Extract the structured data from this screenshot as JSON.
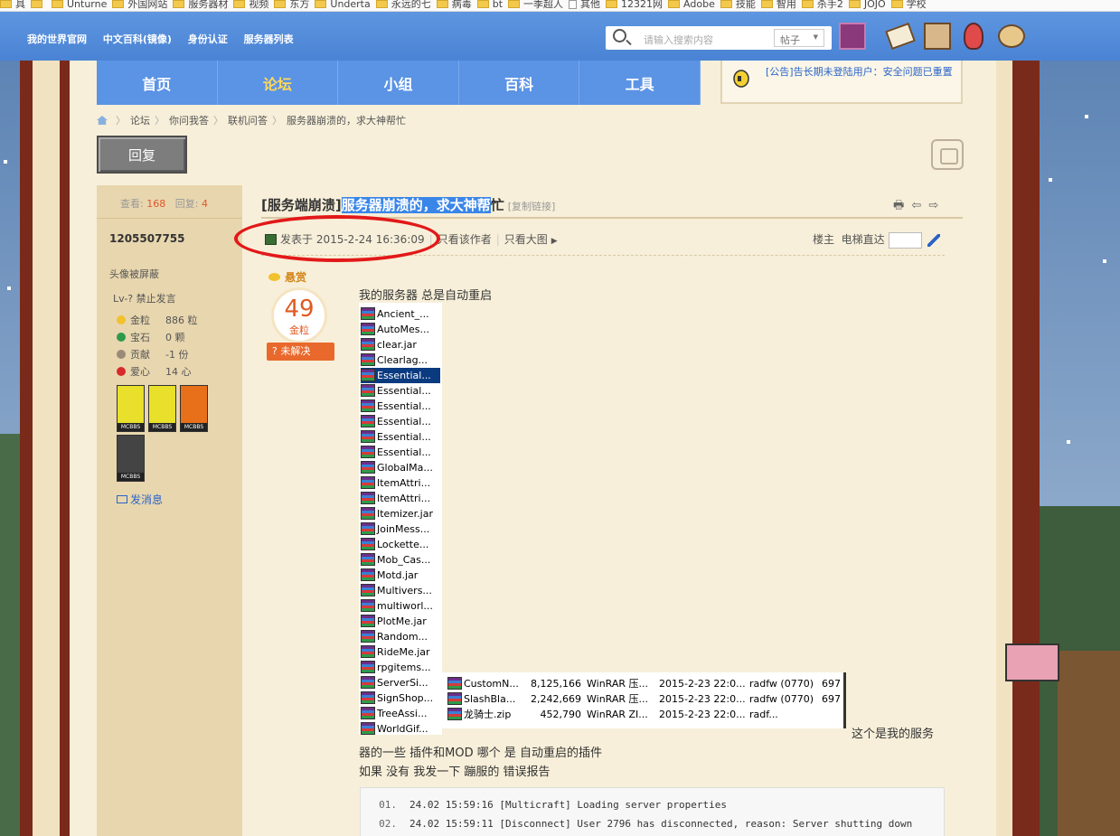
{
  "bookmarks": [
    "具",
    "",
    "Unturne",
    "外国网站",
    "服务器材",
    "视频",
    "东方",
    "Underta",
    "永远的七",
    "病毒",
    "bt",
    "一季超人",
    "其他",
    "12321网",
    "Adobe",
    "技能",
    "智用",
    "杀手2",
    "JOJO",
    "学校"
  ],
  "topnav": {
    "links": [
      "我的世界官网",
      "中文百科(镜像)",
      "身份认证",
      "服务器列表"
    ],
    "search_placeholder": "请输入搜索内容",
    "search_scope": "帖子"
  },
  "forumnav": {
    "tabs": [
      "首页",
      "论坛",
      "小组",
      "百科",
      "工具"
    ],
    "active": 1
  },
  "notice": "[公告]告长期未登陆用户：安全问题已重置",
  "breadcrumb": [
    "论坛",
    "你问我答",
    "联机问答",
    "服务器崩溃的，求大神帮忙"
  ],
  "reply_button": "回复",
  "stats": {
    "views_label": "查看:",
    "views": "168",
    "replies_label": "回复:",
    "replies": "4"
  },
  "user": {
    "name": "1205507755",
    "avatar_note": "头像被屏蔽",
    "level": "Lv-? 禁止发言",
    "stats": [
      {
        "label": "金粒",
        "value": "886 粒",
        "color": "#f2c12e"
      },
      {
        "label": "宝石",
        "value": "0 颗",
        "color": "#2e9a4a"
      },
      {
        "label": "贡献",
        "value": "-1 份",
        "color": "#9a8a78"
      },
      {
        "label": "爱心",
        "value": "14 心",
        "color": "#d82a2a"
      }
    ],
    "medals": [
      "MCBBS",
      "MCBBS",
      "MCBBS",
      "MCBBS"
    ],
    "send_message": "发消息"
  },
  "post": {
    "title_prefix": "[服务端崩溃]",
    "title_highlight": "服务器崩溃的，求大神帮",
    "title_rest": "忙",
    "copy_link": "[复制链接]",
    "title_icons": "🖶 ⇦ ⇨",
    "posted": "发表于 2015-2-24 16:36:09",
    "view_author": "只看该作者",
    "view_big": "只看大图",
    "floor_owner": "楼主",
    "elevator": "电梯直达",
    "bounty_label": "悬赏",
    "bounty_amount": "49",
    "bounty_unit": "金粒",
    "unsolved": "? 未解决",
    "line1": "我的服务器 总是自动重启",
    "tail": "这个是我的服务",
    "line2": "器的一些   插件和MOD  哪个 是 自动重启的插件",
    "line3": "如果 没有 我发一下 蹦服的 错误报告"
  },
  "files": [
    "Ancient_...",
    "AutoMes...",
    "clear.jar",
    "Clearlag...",
    "Essential...",
    "Essential...",
    "Essential...",
    "Essential...",
    "Essential...",
    "Essential...",
    "GlobalMa...",
    "ItemAttri...",
    "ItemAttri...",
    "Itemizer.jar",
    "JoinMess...",
    "Lockette...",
    "Mob_Cas...",
    "Motd.jar",
    "Multivers...",
    "multiworl...",
    "PlotMe.jar",
    "Random...",
    "RideMe.jar",
    "rpgitems...",
    "ServerSi...",
    "SignShop...",
    "TreeAssi...",
    "WorldGif..."
  ],
  "files_selected": 4,
  "files2": [
    {
      "name": "CustomN...",
      "size": "8,125,166",
      "type": "WinRAR 压...",
      "date": "2015-2-23 22:0...",
      "attr": "radfw (0770)",
      "n": "697"
    },
    {
      "name": "SlashBla...",
      "size": "2,242,669",
      "type": "WinRAR 压...",
      "date": "2015-2-23 22:0...",
      "attr": "radfw (0770)",
      "n": "697"
    },
    {
      "name": "龙骑士.zip",
      "size": "452,790",
      "type": "WinRAR ZI...",
      "date": "2015-2-23 22:0...",
      "attr": "radf...",
      "n": ""
    }
  ],
  "code": [
    {
      "no": "01.",
      "text": "24.02 15:59:16 [Multicraft] Loading server properties"
    },
    {
      "no": "02.",
      "text": "24.02 15:59:11 [Disconnect] User 2796 has disconnected, reason: Server shutting down"
    }
  ]
}
